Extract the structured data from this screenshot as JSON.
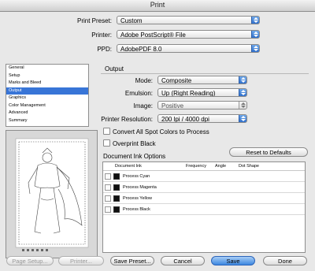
{
  "window": {
    "title": "Print"
  },
  "header": {
    "print_preset": {
      "label": "Print Preset:",
      "value": "Custom"
    },
    "printer": {
      "label": "Printer:",
      "value": "Adobe PostScript® File"
    },
    "ppd": {
      "label": "PPD:",
      "value": "AdobePDF 8.0"
    }
  },
  "categories": {
    "items": [
      "General",
      "Setup",
      "Marks and Bleed",
      "Output",
      "Graphics",
      "Color Management",
      "Advanced",
      "Summary"
    ],
    "selected": "Output"
  },
  "output": {
    "title": "Output",
    "mode": {
      "label": "Mode:",
      "value": "Composite"
    },
    "emulsion": {
      "label": "Emulsion:",
      "value": "Up (Right Reading)"
    },
    "image": {
      "label": "Image:",
      "value": "Positive"
    },
    "printer_resolution": {
      "label": "Printer Resolution:",
      "value": "200 lpi / 4000 dpi"
    },
    "convert_spot": {
      "label": "Convert All Spot Colors to Process",
      "checked": false
    },
    "overprint_black": {
      "label": "Overprint Black",
      "checked": false
    },
    "reset_button": "Reset to Defaults"
  },
  "ink_options": {
    "title": "Document Ink Options",
    "columns": {
      "ink": "Document Ink",
      "frequency": "Frequency",
      "angle": "Angle",
      "dot_shape": "Dot Shape"
    },
    "inks": [
      "Process Cyan",
      "Process Magenta",
      "Process Yellow",
      "Process Black"
    ]
  },
  "footer": {
    "page_setup": "Page Setup...",
    "printer": "Printer...",
    "save_preset": "Save Preset...",
    "cancel": "Cancel",
    "save": "Save",
    "done": "Done"
  },
  "colors": {
    "accent": "#3875d7",
    "default_button": "#3c87e0"
  }
}
